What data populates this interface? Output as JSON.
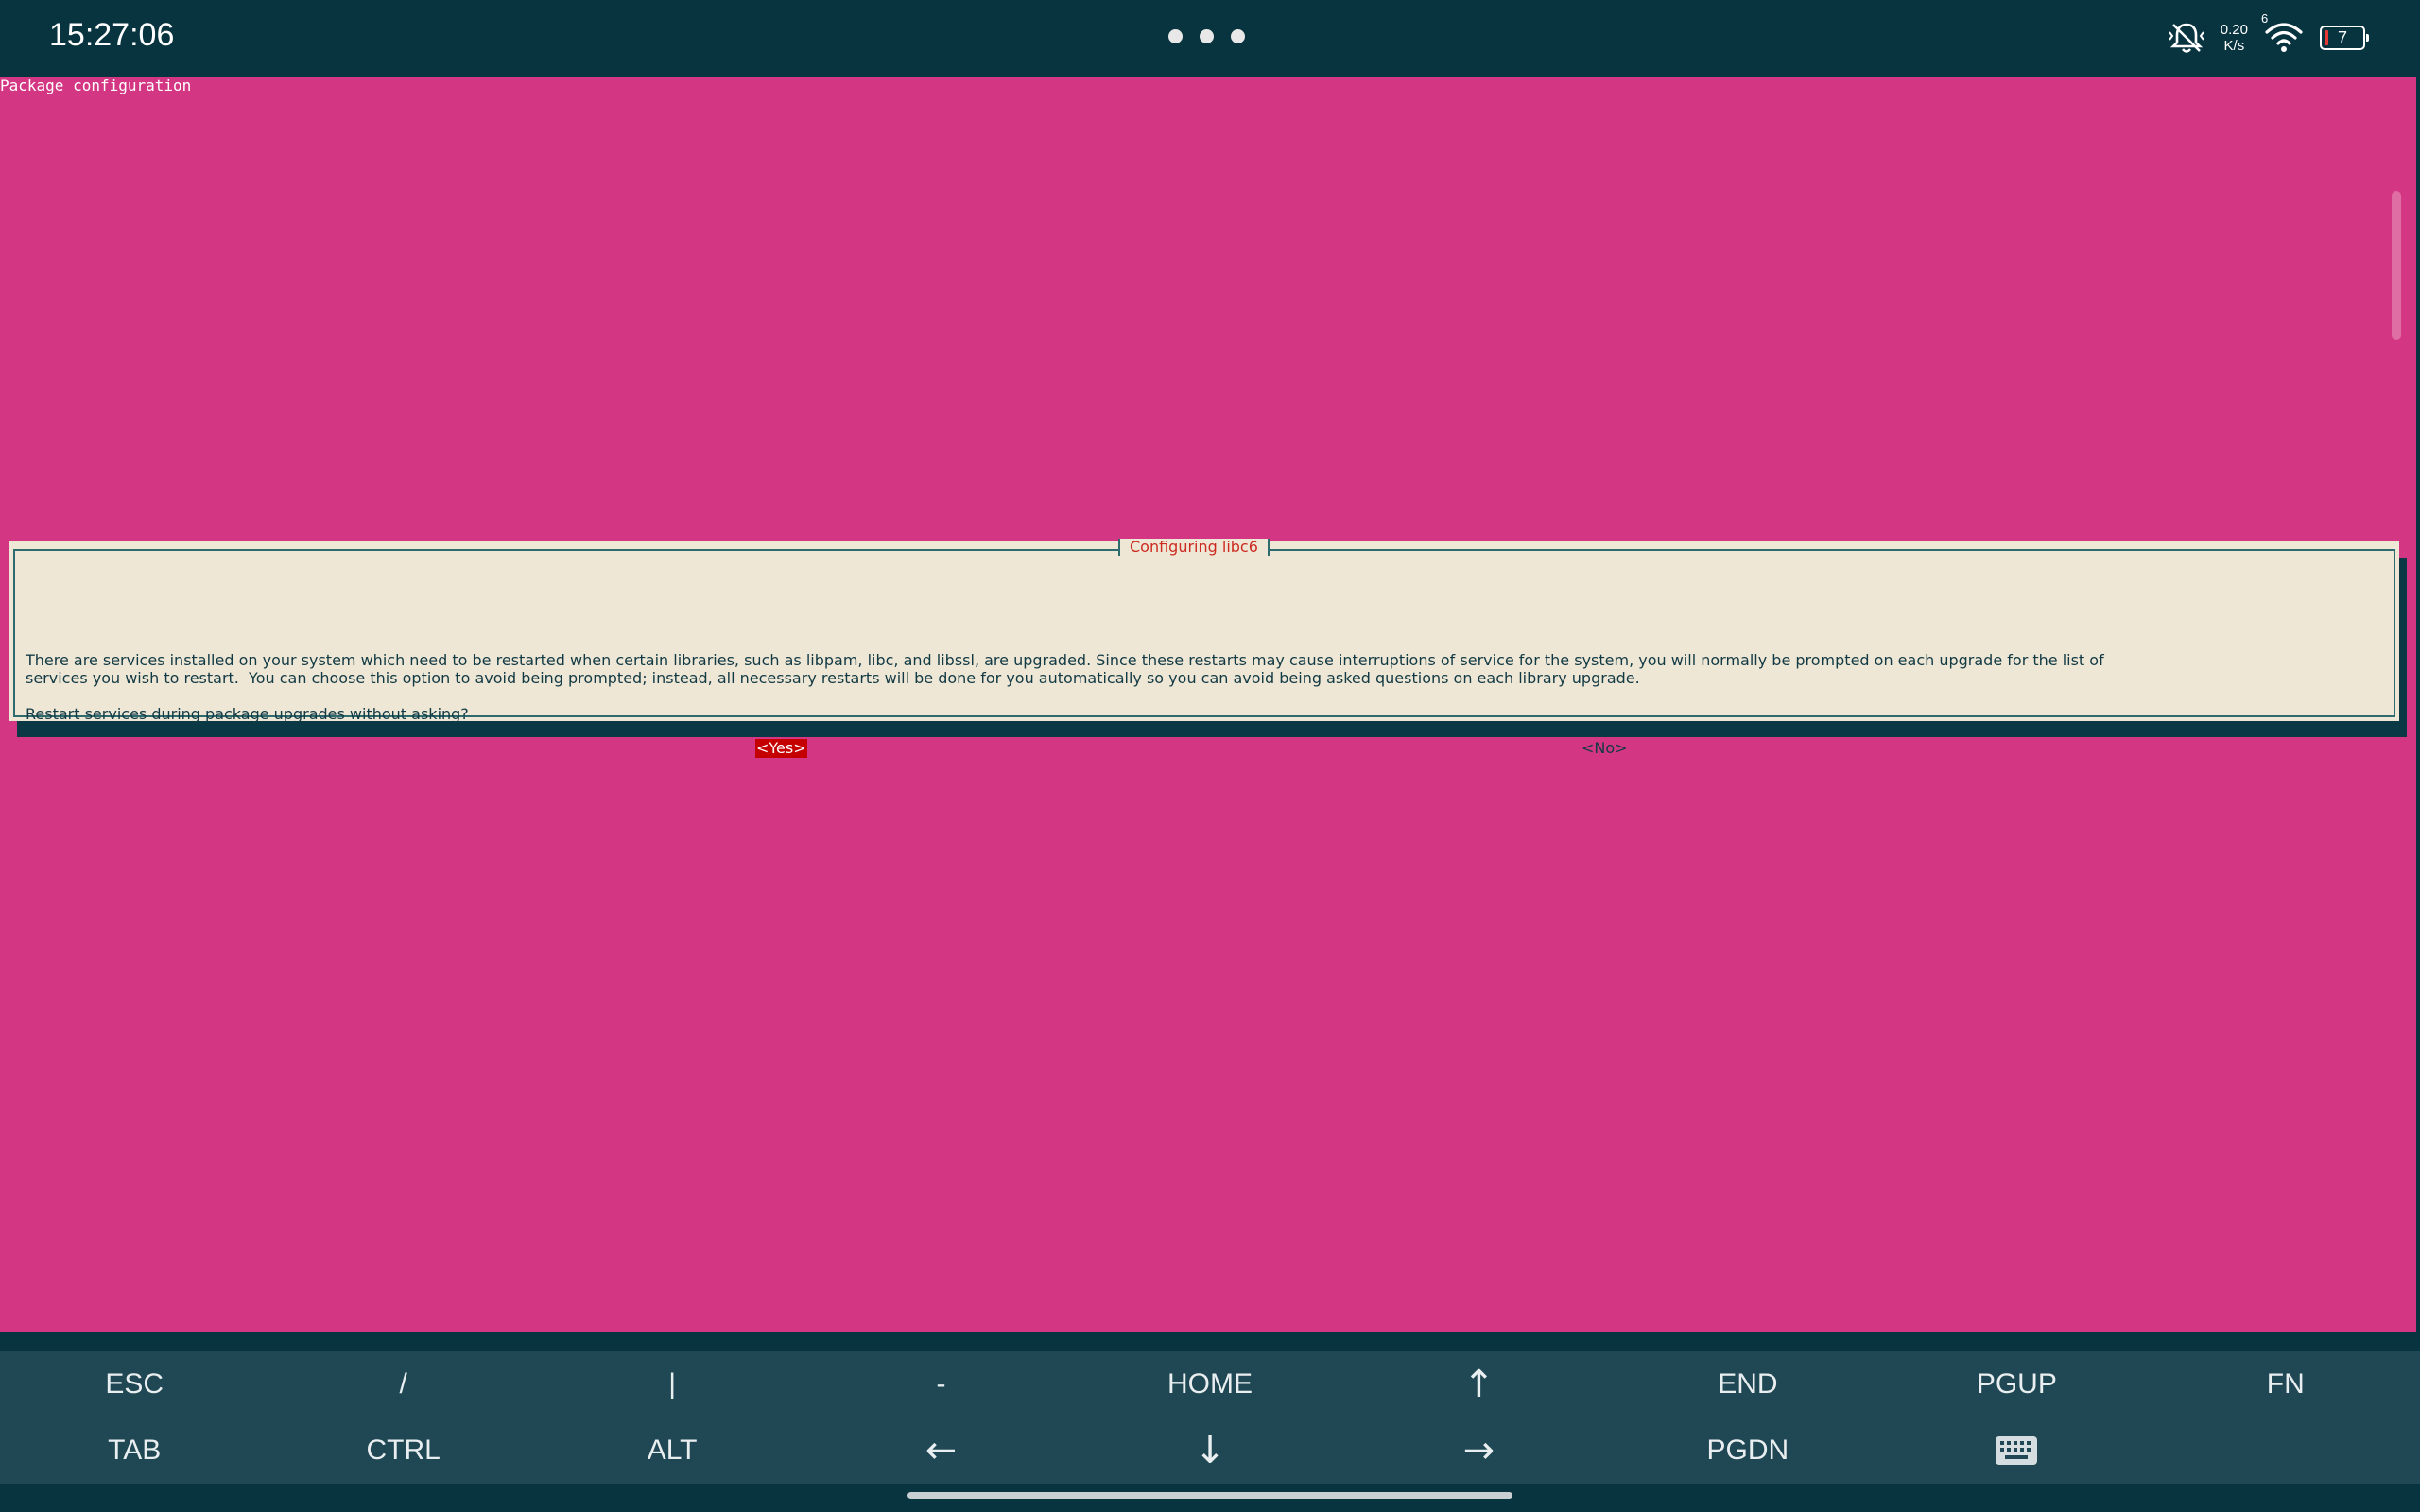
{
  "status_bar": {
    "time": "15:27:06",
    "net_speed_value": "0.20",
    "net_speed_unit": "K/s",
    "wifi_badge": "6",
    "battery_level": "7",
    "icons": [
      "bell-muted-icon",
      "wifi-icon",
      "battery-icon"
    ]
  },
  "terminal": {
    "header": "Package configuration",
    "dialog": {
      "title": "Configuring libc6",
      "lines": [
        "There are services installed on your system which need to be restarted when certain libraries, such as libpam, libc, and libssl, are upgraded. Since these restarts may cause interruptions of service for the system, you will normally be prompted on each upgrade for the list of",
        "services you wish to restart.  You can choose this option to avoid being prompted; instead, all necessary restarts will be done for you automatically so you can avoid being asked questions on each library upgrade.",
        "Restart services during package upgrades without asking?"
      ],
      "yes_label": "<Yes>",
      "no_label": "<No>"
    }
  },
  "extra_keys": {
    "row1": [
      "ESC",
      "/",
      "|",
      "-",
      "HOME",
      "↑",
      "END",
      "PGUP",
      "FN"
    ],
    "row2": [
      "TAB",
      "CTRL",
      "ALT",
      "←",
      "↓",
      "→",
      "PGDN",
      "keyboard-icon"
    ]
  },
  "colors": {
    "terminal_bg": "#d33682",
    "dialog_bg": "#efe7d6",
    "dialog_title": "#cc2b22",
    "selected_button_bg": "#c40000",
    "status_bar_bg": "#083440",
    "extra_keys_bg": "#204854"
  }
}
